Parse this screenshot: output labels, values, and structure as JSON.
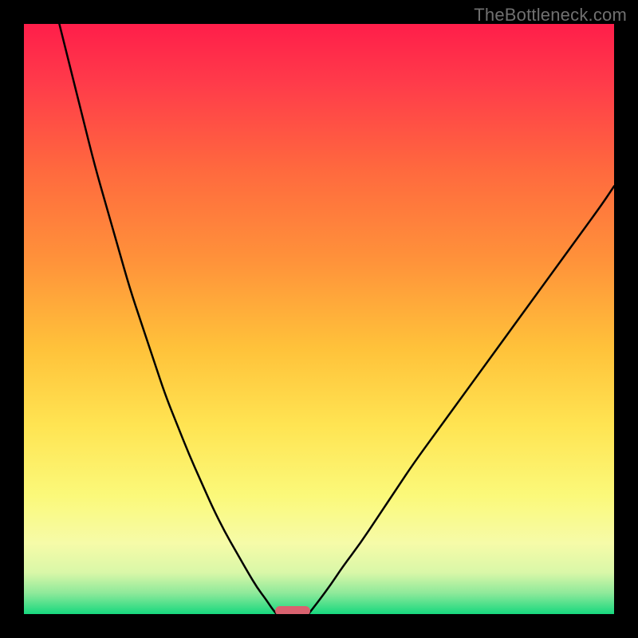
{
  "watermark": "TheBottleneck.com",
  "chart_data": {
    "type": "line",
    "title": "",
    "xlabel": "",
    "ylabel": "",
    "xlim": [
      0,
      100
    ],
    "ylim": [
      0,
      100
    ],
    "grid": false,
    "legend": false,
    "background_gradient_stops": [
      {
        "offset": 0.0,
        "color": "#ff1e4a"
      },
      {
        "offset": 0.1,
        "color": "#ff3b4a"
      },
      {
        "offset": 0.25,
        "color": "#ff6a3e"
      },
      {
        "offset": 0.4,
        "color": "#ff923a"
      },
      {
        "offset": 0.55,
        "color": "#ffc23a"
      },
      {
        "offset": 0.68,
        "color": "#ffe452"
      },
      {
        "offset": 0.8,
        "color": "#fbf97a"
      },
      {
        "offset": 0.88,
        "color": "#f6fba8"
      },
      {
        "offset": 0.93,
        "color": "#d9f7a8"
      },
      {
        "offset": 0.965,
        "color": "#8de99a"
      },
      {
        "offset": 1.0,
        "color": "#17d87e"
      }
    ],
    "series": [
      {
        "name": "bottleneck-curve-left",
        "x": [
          6,
          8,
          10,
          12,
          14,
          16,
          18,
          20,
          22,
          24,
          26,
          28,
          30,
          32,
          34,
          36,
          38,
          39.5,
          41,
          42,
          42.8
        ],
        "y": [
          100,
          92,
          84,
          76,
          69,
          62,
          55,
          49,
          43,
          37,
          32,
          27,
          22.5,
          18,
          14,
          10.5,
          7,
          4.5,
          2.5,
          1,
          0
        ]
      },
      {
        "name": "bottleneck-curve-right",
        "x": [
          48.2,
          49,
          50,
          52,
          54,
          57,
          60,
          63,
          66,
          70,
          74,
          78,
          82,
          86,
          90,
          94,
          98,
          100
        ],
        "y": [
          0,
          1,
          2.3,
          5,
          8,
          12,
          16.5,
          21,
          25.5,
          31,
          36.5,
          42,
          47.5,
          53,
          58.5,
          64,
          69.5,
          72.5
        ]
      }
    ],
    "marker": {
      "name": "bottleneck-range",
      "x": 45.5,
      "y": 0.5,
      "width_pct": 6.0,
      "height_pct": 1.6,
      "color": "#d9626f"
    }
  }
}
